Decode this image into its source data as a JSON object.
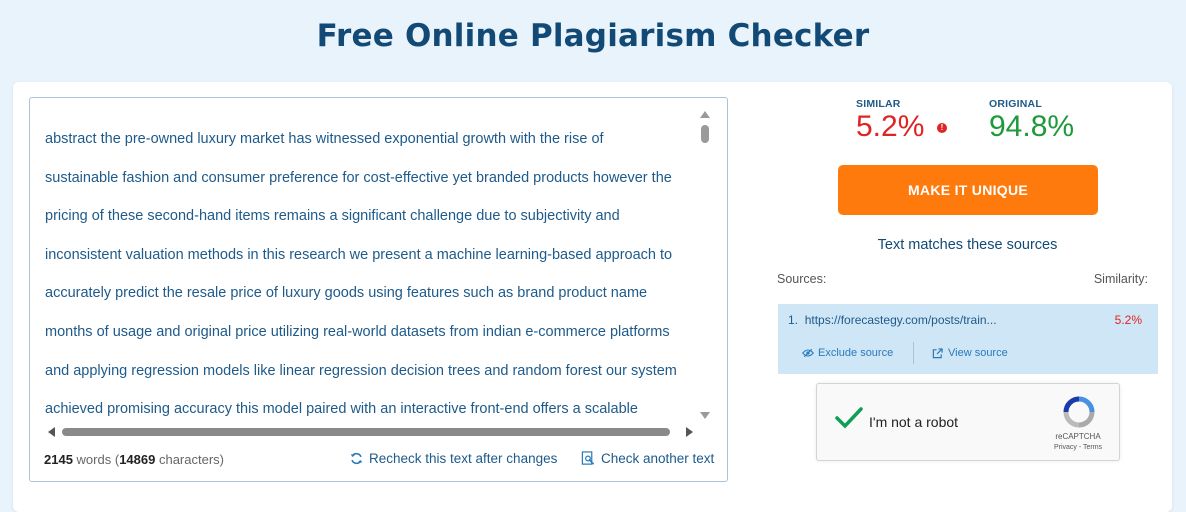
{
  "page": {
    "title": "Free Online Plagiarism Checker"
  },
  "editor": {
    "lines": [
      "abstract the pre-owned luxury market has witnessed exponential growth with the rise of",
      "sustainable fashion and consumer preference for cost-effective yet branded products however the",
      "pricing of these second-hand items remains a significant challenge due to subjectivity and",
      "inconsistent valuation methods in this research we present a machine learning-based approach to",
      "accurately predict the resale price of luxury goods using features such as brand product name",
      "months of usage and original price utilizing real-world datasets from indian e-commerce platforms",
      "and applying regression models like linear regression decision trees and random forest our system",
      "achieved promising accuracy this model paired with an interactive front-end offers a scalable"
    ],
    "word_count": "2145",
    "words_label": "words",
    "char_count": "14869",
    "chars_label": "characters",
    "recheck_label": "Recheck this text after changes",
    "check_another_label": "Check another text"
  },
  "results": {
    "similar_label": "SIMILAR",
    "similar_value": "5.2%",
    "original_label": "ORIGINAL",
    "original_value": "94.8%",
    "make_unique_label": "MAKE IT UNIQUE",
    "matches_heading": "Text matches these sources",
    "sources_label": "Sources:",
    "similarity_label": "Similarity:",
    "sources": [
      {
        "index": "1.",
        "url": "https://forecastegy.com/posts/train...",
        "similarity": "5.2%",
        "exclude_label": "Exclude source",
        "view_label": "View source"
      }
    ]
  },
  "recaptcha": {
    "label": "I'm not a robot",
    "brand": "reCAPTCHA",
    "terms": "Privacy - Terms"
  },
  "colors": {
    "accent": "#ff7a0d",
    "similar": "#e02424",
    "original": "#1e9a3a",
    "text": "#1e5a8a"
  }
}
